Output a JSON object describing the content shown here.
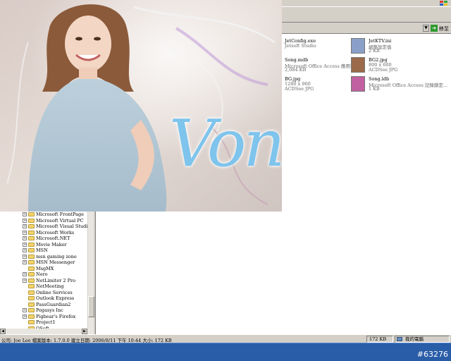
{
  "explorer": {
    "go_label": "移至",
    "files": [
      {
        "name": "JetConfig.exe",
        "desc": "Jetsoft Studio",
        "size": "",
        "icon": "app-icon"
      },
      {
        "name": "JetKTV.ini",
        "desc": "組態設定值",
        "size": "2 KB",
        "icon": "ini-settings-icon"
      },
      {
        "name": "Song.mdb",
        "desc": "Microsoft Office Access 應用程式",
        "size": "2,084 KB",
        "icon": "access-db-icon"
      },
      {
        "name": "BG2.jpg",
        "desc": "800 x 600",
        "size": "ACDSee JPG",
        "icon": "jpg-image-icon"
      },
      {
        "name": "BG.jpg",
        "desc": "1280 x 960",
        "size": "ACDSee JPG",
        "icon": "jpg-image-icon"
      },
      {
        "name": "Song.ldb",
        "desc": "Microsoft Office Access 記錄鎖定...",
        "size": "1 KB",
        "icon": "ldb-lock-icon"
      }
    ],
    "tree": [
      {
        "label": "Microsoft FrontPage",
        "expander": "+"
      },
      {
        "label": "Microsoft Virtual PC",
        "expander": "+"
      },
      {
        "label": "Microsoft Visual Studio",
        "expander": "+"
      },
      {
        "label": "Microsoft Works",
        "expander": "+"
      },
      {
        "label": "Microsoft.NET",
        "expander": "+"
      },
      {
        "label": "Movie Maker",
        "expander": "+"
      },
      {
        "label": "MSN",
        "expander": "+"
      },
      {
        "label": "msn gaming zone",
        "expander": "+"
      },
      {
        "label": "MSN Messenger",
        "expander": "+"
      },
      {
        "label": "MsgMX",
        "expander": ""
      },
      {
        "label": "Nero",
        "expander": "+"
      },
      {
        "label": "NetLimiter 2 Pro",
        "expander": "+"
      },
      {
        "label": "NetMeeting",
        "expander": ""
      },
      {
        "label": "Online Services",
        "expander": ""
      },
      {
        "label": "Outlook Express",
        "expander": ""
      },
      {
        "label": "PassGuardian2",
        "expander": ""
      },
      {
        "label": "Pegasys Inc",
        "expander": "+"
      },
      {
        "label": "Pigbear's Firefox",
        "expander": "+"
      },
      {
        "label": "Project1",
        "expander": ""
      },
      {
        "label": "QSoft",
        "expander": ""
      }
    ],
    "status": {
      "main": "公司: Joe Lee 檔案版本: 1.7.0.0 建立日期: 2006/8/11 下午 10:44 大小: 172 KB",
      "size": "172 KB",
      "zone": "我的電腦"
    }
  },
  "wallpaper": {
    "script_text": "Von"
  },
  "taskbar": {
    "tag": "#63276"
  },
  "colors": {
    "taskbar": "#2a5da8",
    "script": "#7ec4ec",
    "window_chrome": "#d4d0c8"
  }
}
